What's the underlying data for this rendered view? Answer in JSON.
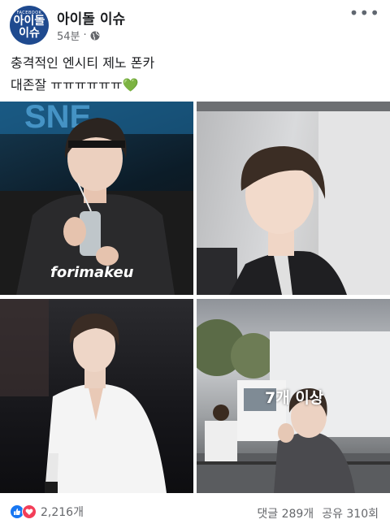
{
  "header": {
    "avatar_small": "FACEBOOK",
    "avatar_line1": "아이돌",
    "avatar_line2": "이슈",
    "page_name": "아이돌 이슈",
    "time": "54분",
    "separator": "·",
    "more": "•••"
  },
  "post": {
    "line1": "충격적인 엔시티 제노 폰카",
    "line2": "대존잘 ㅠㅠㅠㅠㅠㅠ",
    "emoji": "💚"
  },
  "photos": {
    "watermark": "forimakeu",
    "more_overlay": "7개 이상"
  },
  "footer": {
    "reaction_count": "2,216개",
    "comments": "댓글 289개",
    "shares": "공유 310회"
  },
  "colors": {
    "brand": "#1f4a8f",
    "like": "#1877f2",
    "love": "#f33e58"
  }
}
